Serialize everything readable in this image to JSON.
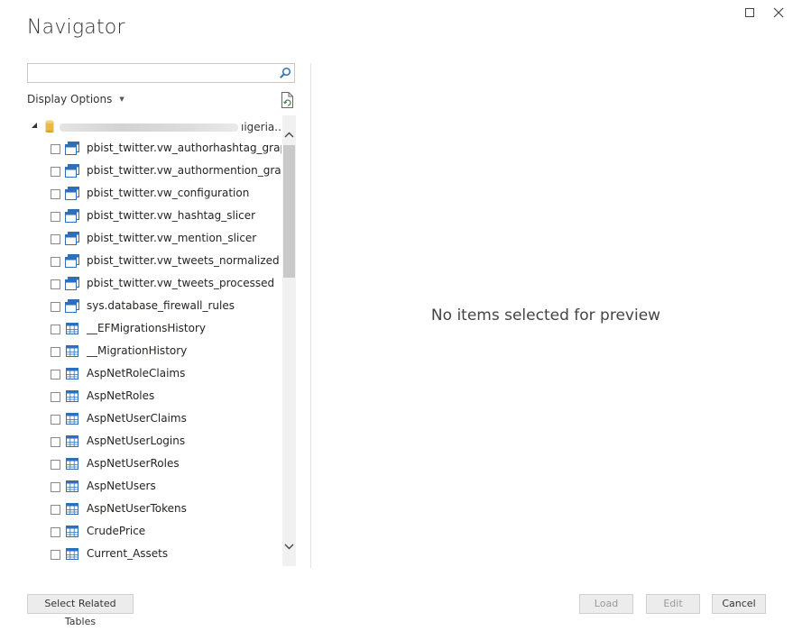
{
  "window": {
    "title": "Navigator",
    "maximize_icon": "maximize-icon",
    "close_icon": "close-icon"
  },
  "search": {
    "value": "",
    "placeholder": "",
    "icon": "search-icon"
  },
  "display_options": {
    "label": "Display Options",
    "caret": "▼"
  },
  "tree": {
    "root_label": "ıigeria...",
    "root_icon": "database-icon",
    "items": [
      {
        "label": "pbist_twitter.vw_authorhashtag_graph",
        "type": "view"
      },
      {
        "label": "pbist_twitter.vw_authormention_graph",
        "type": "view"
      },
      {
        "label": "pbist_twitter.vw_configuration",
        "type": "view"
      },
      {
        "label": "pbist_twitter.vw_hashtag_slicer",
        "type": "view"
      },
      {
        "label": "pbist_twitter.vw_mention_slicer",
        "type": "view"
      },
      {
        "label": "pbist_twitter.vw_tweets_normalized",
        "type": "view"
      },
      {
        "label": "pbist_twitter.vw_tweets_processed",
        "type": "view"
      },
      {
        "label": "sys.database_firewall_rules",
        "type": "view"
      },
      {
        "label": "__EFMigrationsHistory",
        "type": "table"
      },
      {
        "label": "__MigrationHistory",
        "type": "table"
      },
      {
        "label": "AspNetRoleClaims",
        "type": "table"
      },
      {
        "label": "AspNetRoles",
        "type": "table"
      },
      {
        "label": "AspNetUserClaims",
        "type": "table"
      },
      {
        "label": "AspNetUserLogins",
        "type": "table"
      },
      {
        "label": "AspNetUserRoles",
        "type": "table"
      },
      {
        "label": "AspNetUsers",
        "type": "table"
      },
      {
        "label": "AspNetUserTokens",
        "type": "table"
      },
      {
        "label": "CrudePrice",
        "type": "table"
      },
      {
        "label": "Current_Assets",
        "type": "table"
      }
    ]
  },
  "preview": {
    "message": "No items selected for preview"
  },
  "buttons": {
    "select_related": "Select Related Tables",
    "load": "Load",
    "edit": "Edit",
    "cancel": "Cancel"
  },
  "colors": {
    "accent": "#2f6fba",
    "db_icon": "#e8b84a",
    "divider": "#e1e1e1"
  }
}
